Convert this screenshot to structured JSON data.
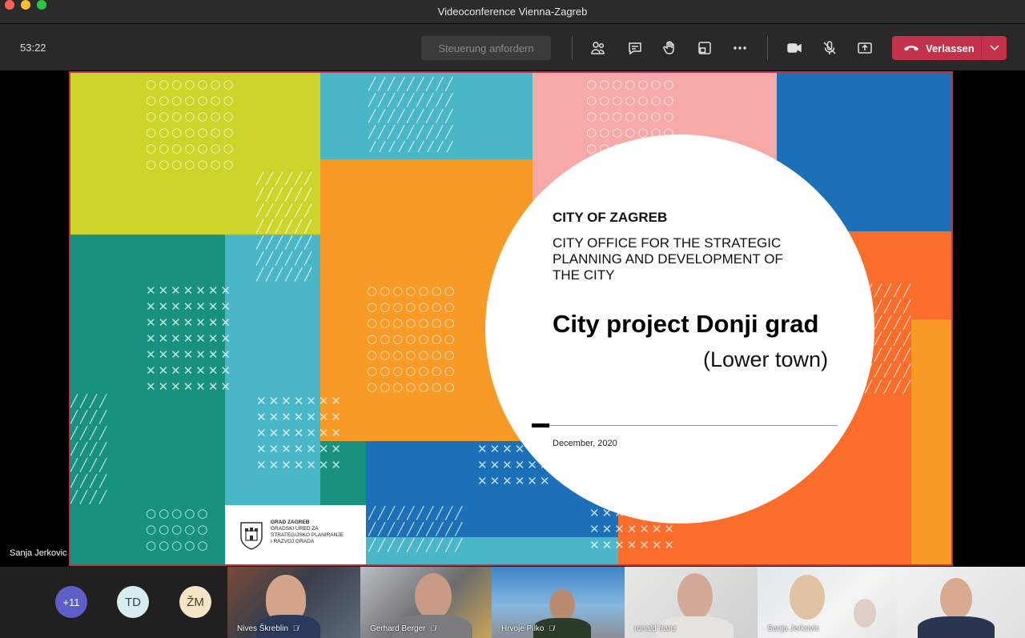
{
  "window": {
    "title": "Videoconference Vienna-Zagreb"
  },
  "toolbar": {
    "timer": "53:22",
    "request_control_label": "Steuerung anfordern",
    "icons": [
      "participants-icon",
      "chat-icon",
      "raise-hand-icon",
      "rooms-icon",
      "more-icon",
      "camera-icon",
      "mic-muted-icon",
      "share-icon"
    ],
    "leave_label": "Verlassen",
    "leave_color": "#c4314b"
  },
  "slide": {
    "title": "CITY OF ZAGREB",
    "office": "CITY OFFICE FOR THE STRATEGIC PLANNING AND DEVELOPMENT OF THE CITY",
    "project": "City project Donji grad",
    "subtitle": "(Lower town)",
    "date": "December, 2020",
    "logo_lines": [
      "GRAD ZAGREB",
      "GRADSKI URED ZA",
      "STRATEGIJSKO PLANIRANJE",
      "I RAZVOJ GRADA"
    ]
  },
  "presenter_name": "Sanja Jerkovic",
  "participants": {
    "overflow": "+11",
    "avatars": [
      {
        "initials": "TD",
        "bg": "#d6eef0",
        "fg": "#2a4a50"
      },
      {
        "initials": "ŽM",
        "bg": "#f5e6c8",
        "fg": "#4a3a1a"
      }
    ],
    "tiles": [
      {
        "name": "Nives Škreblin"
      },
      {
        "name": "Gerhard Berger"
      },
      {
        "name": "Hrvoje Pilko"
      },
      {
        "name": "ronald franz"
      },
      {
        "name": "Sanja Jerkovic"
      },
      {
        "name": ""
      }
    ]
  }
}
